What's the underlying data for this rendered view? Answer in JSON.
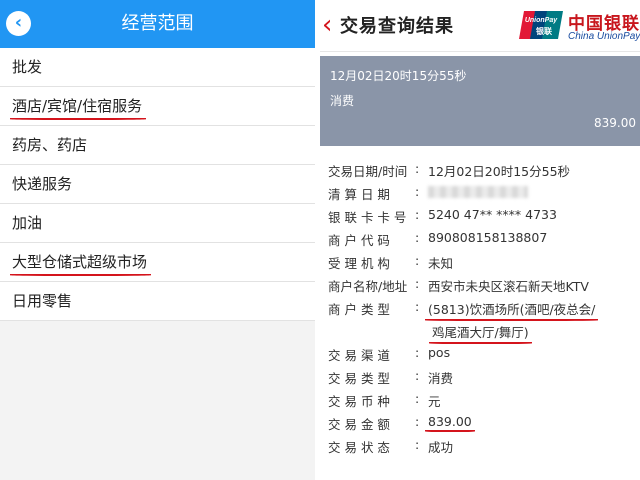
{
  "left": {
    "title": "经营范围",
    "back_icon": "chevron-left-icon",
    "items": [
      {
        "label": "批发",
        "highlighted": false
      },
      {
        "label": "酒店/宾馆/住宿服务",
        "highlighted": true
      },
      {
        "label": "药房、药店",
        "highlighted": false
      },
      {
        "label": "快递服务",
        "highlighted": false
      },
      {
        "label": "加油",
        "highlighted": false
      },
      {
        "label": "大型仓储式超级市场",
        "highlighted": true
      },
      {
        "label": "日用零售",
        "highlighted": false
      }
    ]
  },
  "right": {
    "title": "交易查询结果",
    "brand_cn": "中国银联",
    "brand_en": "China UnionPay",
    "logo_text": "UnionPay",
    "logo_cn": "银联",
    "summary": {
      "time": "12月02日20时15分55秒",
      "type": "消费",
      "amount": "839.00"
    },
    "details": [
      {
        "label": "交易日期/时间",
        "value": "12月02日20时15分55秒"
      },
      {
        "label": "清 算 日 期",
        "value": ""
      },
      {
        "label": "银 联 卡 卡 号",
        "value": "5240 47** **** 4733"
      },
      {
        "label": "商 户 代 码",
        "value": "890808158138807"
      },
      {
        "label": "受 理 机 构",
        "value": "未知"
      },
      {
        "label": "商户名称/地址",
        "value": "西安市未央区滚石新天地KTV"
      },
      {
        "label": "商 户 类 型",
        "value": "(5813)饮酒场所(酒吧/夜总会/",
        "value2": "鸡尾酒大厅/舞厅)"
      },
      {
        "label": "交 易 渠 道",
        "value": "pos"
      },
      {
        "label": "交 易 类 型",
        "value": "消费"
      },
      {
        "label": "交 易 币 种",
        "value": "元"
      },
      {
        "label": "交 易 金 额",
        "value": "839.00"
      },
      {
        "label": "交 易 状 态",
        "value": "成功"
      }
    ]
  },
  "colors": {
    "header_blue": "#2196f3",
    "accent_red": "#d4141c",
    "summary_bg": "#8a95a8"
  }
}
